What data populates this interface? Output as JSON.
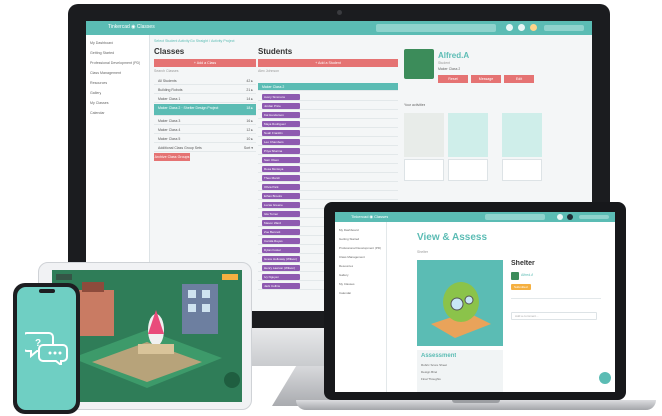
{
  "imac": {
    "app_logo": "Tinkercad ◉ Classes",
    "sidebar": [
      "My Dashboard",
      "Getting Started",
      "Professional Development (PD)",
      "Class Management",
      "Resources",
      "Gallery",
      "My Classes",
      "Calendar"
    ],
    "tabs": [
      "Select Student Activity",
      "Go Straight / Activity Project"
    ],
    "classes": {
      "heading": "Classes",
      "add_button": "+ Add a Class",
      "filter": "Search Classes",
      "rows": [
        {
          "name": "All Students",
          "meta": "42 ▸"
        },
        {
          "name": "Building Robots",
          "meta": "21 ▸"
        },
        {
          "name": "Maker Class 1",
          "meta": "14 ▸"
        },
        {
          "name": "Maker Class 2 · Shelter Design Project",
          "meta": "18 ▸"
        },
        {
          "name": "Maker Class 3",
          "meta": "16 ▸"
        },
        {
          "name": "Maker Class 4",
          "meta": "12 ▸"
        },
        {
          "name": "Maker Class 5",
          "meta": "10 ▸"
        },
        {
          "name": "Additional Class Group Sets",
          "meta": "Sort ▾"
        }
      ],
      "footer_button": "Archive Class Groups"
    },
    "students": {
      "heading": "Students",
      "add_button": "+ Add a Student",
      "filter": "Alex Johnson",
      "selected_class": "Maker Class 2",
      "rows": [
        "Avery Simmons",
        "Jordan Price",
        "Kai Henderson",
        "Maya Rodriguez",
        "Noah Franklin",
        "Leo Chambers",
        "Priya Sharma",
        "Sam Olsen",
        "Rosa Montoya",
        "Theo Marsh",
        "Olivia Park",
        "Ethan Brooks",
        "Lucas Greene",
        "Isla Turner",
        "Mason Ward",
        "Zoe Bennett",
        "Camila Reyes",
        "Dylan Foster",
        "Grace Holloway (Wilson)",
        "Henry Lawson (Wilson)",
        "Ivy Nguyen",
        "Jack Collins"
      ]
    },
    "profile": {
      "name": "Alfred.A",
      "subtitle": "Student",
      "label_class": "Maker Class 2",
      "buttons": [
        "Reset",
        "Message",
        "Edit"
      ],
      "section": "Your activities",
      "colors": {
        "accent": "#5bbcb4",
        "danger": "#e57373",
        "student_tag": "#8e5ab0"
      }
    }
  },
  "laptop": {
    "app_logo": "Tinkercad ◉ Classes",
    "sidebar": [
      "My Dashboard",
      "Getting Started",
      "Professional Development (PD)",
      "Class Management",
      "Resources",
      "Gallery",
      "My Classes",
      "Calendar"
    ],
    "page_title": "View & Assess",
    "breadcrumb": "Shelter",
    "project_title": "Shelter",
    "project_author": "Alfred.A",
    "project_badge": "Submitted",
    "assessment_title": "Assessment",
    "assessment_lines": [
      "Rubric Score Sheet",
      "Design Brief",
      "Final Thoughts"
    ],
    "comment_placeholder": "Add a comment..."
  },
  "phone": {
    "icon": "chat-bubbles-icon"
  }
}
